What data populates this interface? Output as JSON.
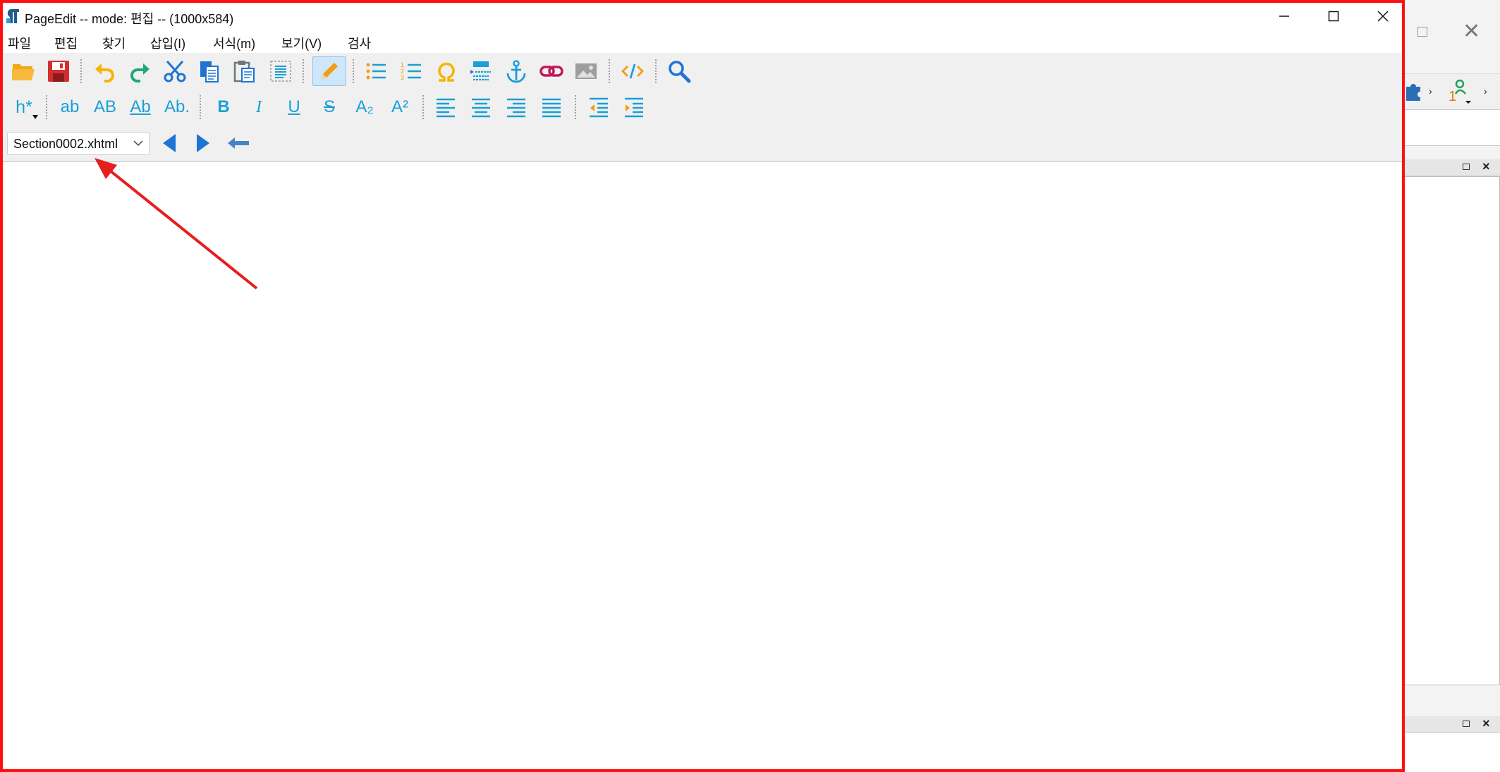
{
  "window": {
    "title": "PageEdit -- mode: 편집 -- (1000x584)"
  },
  "menu": [
    "파일",
    "편집",
    "찾기",
    "삽입(I)",
    "서식(m)",
    "보기(V)",
    "검사"
  ],
  "toolbar2": {
    "heading_label": "h*",
    "lowercase_label": "ab",
    "uppercase_label": "AB",
    "titlecase_label": "Ab",
    "sentencecase_label": "Ab.",
    "bold_label": "B",
    "italic_label": "I",
    "underline_label": "U",
    "strike_label": "S",
    "subscript_label": "A₂",
    "superscript_label": "A²"
  },
  "navigation": {
    "file_selected": "Section0002.xhtml"
  },
  "colors": {
    "window_border": "#ff1010",
    "icon_blue": "#1a9fd6",
    "nav_arrow": "#1e74d2",
    "annotation": "#e61e1e"
  }
}
